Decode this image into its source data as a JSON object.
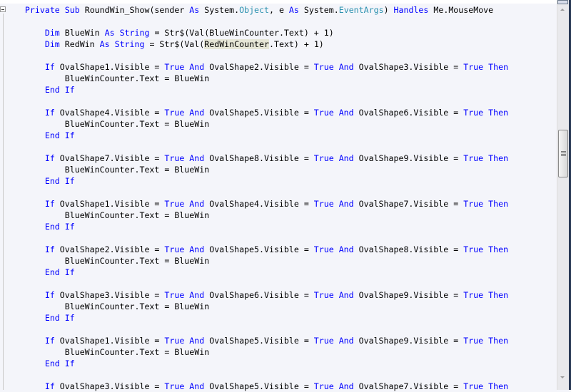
{
  "editor": {
    "colors": {
      "keyword": "#0000ff",
      "type": "#2b91af",
      "text": "#000000",
      "background": "#f4f5fa",
      "highlight": "#e6e6d6"
    },
    "lines": [
      [
        [
          "    ",
          " "
        ],
        [
          "Private",
          "kw"
        ],
        [
          " ",
          "t"
        ],
        [
          "Sub",
          "kw"
        ],
        [
          " RoundWin_Show(sender ",
          "t"
        ],
        [
          "As",
          "kw"
        ],
        [
          " System.",
          "t"
        ],
        [
          "Object",
          "ty"
        ],
        [
          ", e ",
          "t"
        ],
        [
          "As",
          "kw"
        ],
        [
          " System.",
          "t"
        ],
        [
          "EventArgs",
          "ty"
        ],
        [
          ") ",
          "t"
        ],
        [
          "Handles",
          "kw"
        ],
        [
          " Me.MouseMove",
          "t"
        ]
      ],
      [],
      [
        [
          "        ",
          "t"
        ],
        [
          "Dim",
          "kw"
        ],
        [
          " BlueWin ",
          "t"
        ],
        [
          "As",
          "kw"
        ],
        [
          " ",
          "t"
        ],
        [
          "String",
          "kw"
        ],
        [
          " = Str$(Val(BlueWinCounter.Text) + 1)",
          "t"
        ]
      ],
      [
        [
          "        ",
          "t"
        ],
        [
          "Dim",
          "kw"
        ],
        [
          " RedWin ",
          "t"
        ],
        [
          "As",
          "kw"
        ],
        [
          " ",
          "t"
        ],
        [
          "String",
          "kw"
        ],
        [
          " = Str$(Val(",
          "t"
        ],
        [
          "RedWinCounter",
          "hl"
        ],
        [
          ".Text) + 1)",
          "t"
        ]
      ],
      [],
      [
        [
          "        ",
          "t"
        ],
        [
          "If",
          "kw"
        ],
        [
          " OvalShape1.Visible = ",
          "t"
        ],
        [
          "True",
          "kw"
        ],
        [
          " ",
          "t"
        ],
        [
          "And",
          "kw"
        ],
        [
          " OvalShape2.Visible = ",
          "t"
        ],
        [
          "True",
          "kw"
        ],
        [
          " ",
          "t"
        ],
        [
          "And",
          "kw"
        ],
        [
          " OvalShape3.Visible = ",
          "t"
        ],
        [
          "True",
          "kw"
        ],
        [
          " ",
          "t"
        ],
        [
          "Then",
          "kw"
        ]
      ],
      [
        [
          "            BlueWinCounter.Text = BlueWin",
          "t"
        ]
      ],
      [
        [
          "        ",
          "t"
        ],
        [
          "End If",
          "kw"
        ]
      ],
      [],
      [
        [
          "        ",
          "t"
        ],
        [
          "If",
          "kw"
        ],
        [
          " OvalShape4.Visible = ",
          "t"
        ],
        [
          "True",
          "kw"
        ],
        [
          " ",
          "t"
        ],
        [
          "And",
          "kw"
        ],
        [
          " OvalShape5.Visible = ",
          "t"
        ],
        [
          "True",
          "kw"
        ],
        [
          " ",
          "t"
        ],
        [
          "And",
          "kw"
        ],
        [
          " OvalShape6.Visible = ",
          "t"
        ],
        [
          "True",
          "kw"
        ],
        [
          " ",
          "t"
        ],
        [
          "Then",
          "kw"
        ]
      ],
      [
        [
          "            BlueWinCounter.Text = BlueWin",
          "t"
        ]
      ],
      [
        [
          "        ",
          "t"
        ],
        [
          "End If",
          "kw"
        ]
      ],
      [],
      [
        [
          "        ",
          "t"
        ],
        [
          "If",
          "kw"
        ],
        [
          " OvalShape7.Visible = ",
          "t"
        ],
        [
          "True",
          "kw"
        ],
        [
          " ",
          "t"
        ],
        [
          "And",
          "kw"
        ],
        [
          " OvalShape8.Visible = ",
          "t"
        ],
        [
          "True",
          "kw"
        ],
        [
          " ",
          "t"
        ],
        [
          "And",
          "kw"
        ],
        [
          " OvalShape9.Visible = ",
          "t"
        ],
        [
          "True",
          "kw"
        ],
        [
          " ",
          "t"
        ],
        [
          "Then",
          "kw"
        ]
      ],
      [
        [
          "            BlueWinCounter.Text = BlueWin",
          "t"
        ]
      ],
      [
        [
          "        ",
          "t"
        ],
        [
          "End If",
          "kw"
        ]
      ],
      [],
      [
        [
          "        ",
          "t"
        ],
        [
          "If",
          "kw"
        ],
        [
          " OvalShape1.Visible = ",
          "t"
        ],
        [
          "True",
          "kw"
        ],
        [
          " ",
          "t"
        ],
        [
          "And",
          "kw"
        ],
        [
          " OvalShape4.Visible = ",
          "t"
        ],
        [
          "True",
          "kw"
        ],
        [
          " ",
          "t"
        ],
        [
          "And",
          "kw"
        ],
        [
          " OvalShape7.Visible = ",
          "t"
        ],
        [
          "True",
          "kw"
        ],
        [
          " ",
          "t"
        ],
        [
          "Then",
          "kw"
        ]
      ],
      [
        [
          "            BlueWinCounter.Text = BlueWin",
          "t"
        ]
      ],
      [
        [
          "        ",
          "t"
        ],
        [
          "End If",
          "kw"
        ]
      ],
      [],
      [
        [
          "        ",
          "t"
        ],
        [
          "If",
          "kw"
        ],
        [
          " OvalShape2.Visible = ",
          "t"
        ],
        [
          "True",
          "kw"
        ],
        [
          " ",
          "t"
        ],
        [
          "And",
          "kw"
        ],
        [
          " OvalShape5.Visible = ",
          "t"
        ],
        [
          "True",
          "kw"
        ],
        [
          " ",
          "t"
        ],
        [
          "And",
          "kw"
        ],
        [
          " OvalShape8.Visible = ",
          "t"
        ],
        [
          "True",
          "kw"
        ],
        [
          " ",
          "t"
        ],
        [
          "Then",
          "kw"
        ]
      ],
      [
        [
          "            BlueWinCounter.Text = BlueWin",
          "t"
        ]
      ],
      [
        [
          "        ",
          "t"
        ],
        [
          "End If",
          "kw"
        ]
      ],
      [],
      [
        [
          "        ",
          "t"
        ],
        [
          "If",
          "kw"
        ],
        [
          " OvalShape3.Visible = ",
          "t"
        ],
        [
          "True",
          "kw"
        ],
        [
          " ",
          "t"
        ],
        [
          "And",
          "kw"
        ],
        [
          " OvalShape6.Visible = ",
          "t"
        ],
        [
          "True",
          "kw"
        ],
        [
          " ",
          "t"
        ],
        [
          "And",
          "kw"
        ],
        [
          " OvalShape9.Visible = ",
          "t"
        ],
        [
          "True",
          "kw"
        ],
        [
          " ",
          "t"
        ],
        [
          "Then",
          "kw"
        ]
      ],
      [
        [
          "            BlueWinCounter.Text = BlueWin",
          "t"
        ]
      ],
      [
        [
          "        ",
          "t"
        ],
        [
          "End If",
          "kw"
        ]
      ],
      [],
      [
        [
          "        ",
          "t"
        ],
        [
          "If",
          "kw"
        ],
        [
          " OvalShape1.Visible = ",
          "t"
        ],
        [
          "True",
          "kw"
        ],
        [
          " ",
          "t"
        ],
        [
          "And",
          "kw"
        ],
        [
          " OvalShape5.Visible = ",
          "t"
        ],
        [
          "True",
          "kw"
        ],
        [
          " ",
          "t"
        ],
        [
          "And",
          "kw"
        ],
        [
          " OvalShape9.Visible = ",
          "t"
        ],
        [
          "True",
          "kw"
        ],
        [
          " ",
          "t"
        ],
        [
          "Then",
          "kw"
        ]
      ],
      [
        [
          "            BlueWinCounter.Text = BlueWin",
          "t"
        ]
      ],
      [
        [
          "        ",
          "t"
        ],
        [
          "End If",
          "kw"
        ]
      ],
      [],
      [
        [
          "        ",
          "t"
        ],
        [
          "If",
          "kw"
        ],
        [
          " OvalShape3.Visible = ",
          "t"
        ],
        [
          "True",
          "kw"
        ],
        [
          " ",
          "t"
        ],
        [
          "And",
          "kw"
        ],
        [
          " OvalShape5.Visible = ",
          "t"
        ],
        [
          "True",
          "kw"
        ],
        [
          " ",
          "t"
        ],
        [
          "And",
          "kw"
        ],
        [
          " OvalShape7.Visible = ",
          "t"
        ],
        [
          "True",
          "kw"
        ],
        [
          " ",
          "t"
        ],
        [
          "Then",
          "kw"
        ]
      ]
    ]
  },
  "scrollbar": {
    "position_fraction": 0.33
  }
}
